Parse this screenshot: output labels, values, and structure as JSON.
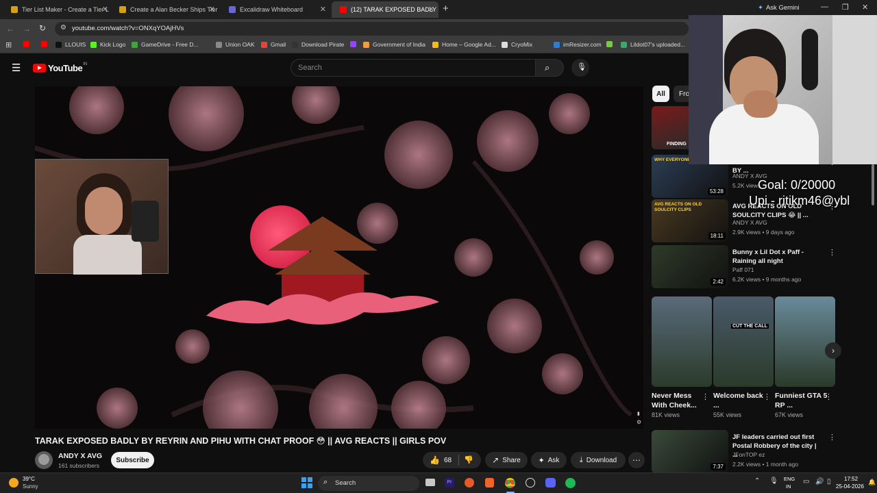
{
  "browser": {
    "tabs": [
      {
        "label": "Tier List Maker - Create a Tier L",
        "color": "#d4a017"
      },
      {
        "label": "Create a Alan Becker Ships Tier",
        "color": "#d4a017"
      },
      {
        "label": "Excalidraw Whiteboard",
        "color": "#6965db"
      },
      {
        "label": "(12) TARAK EXPOSED BADLY BY",
        "color": "#ff0000"
      }
    ],
    "new_tab": "+",
    "ask_gemini": "Ask Gemini",
    "url": "youtube.com/watch?v=ONXqYOAjHVs",
    "bookmarks": [
      {
        "label": "",
        "color": "#ff0000"
      },
      {
        "label": "",
        "color": "#ff0000"
      },
      {
        "label": "LLOUIS",
        "color": "#111111"
      },
      {
        "label": "Kick Logo",
        "color": "#53fc18"
      },
      {
        "label": "GameDrive - Free D...",
        "color": "#3ca83c"
      },
      {
        "label": "Union OAK",
        "color": "#888888"
      },
      {
        "label": "Gmail",
        "color": "#ea4335"
      },
      {
        "label": "Download Pirate",
        "color": "#333333"
      },
      {
        "label": "",
        "color": "#9146ff"
      },
      {
        "label": "Government of India",
        "color": "#ff9933"
      },
      {
        "label": "Home – Google Ad...",
        "color": "#fbbc04"
      },
      {
        "label": "CryoMix",
        "color": "#dddddd"
      },
      {
        "label": "imResizer.com",
        "color": "#2a7fd4"
      },
      {
        "label": "",
        "color": "#7ac943"
      },
      {
        "label": "Lildot07's uploaded...",
        "color": "#3ca86c"
      }
    ]
  },
  "youtube": {
    "logo_text": "YouTube",
    "region": "IN",
    "search_placeholder": "Search",
    "chips": [
      "All",
      "Fro"
    ],
    "video_title": "TARAK EXPOSED BADLY BY REYRIN AND PIHU WITH CHAT PROOF 😳 || AVG REACTS || GIRLS POV",
    "channel": "ANDY X AVG",
    "subscribers": "161 subscribers",
    "subscribe": "Subscribe",
    "likes": "68",
    "share": "Share",
    "ask": "Ask",
    "download": "Download",
    "stream_overlay": {
      "goal": "Goal: 0/20000",
      "upi": "Upi - ritikm46@ybl"
    },
    "recommendations": [
      {
        "title": "MANAGEMENT EXPOSED BY ...",
        "channel": "ANDY X AVG",
        "meta": "5.2K views",
        "duration": "53:28",
        "thumb_text": "WHY EVERYONE LEA",
        "thumb_color": "#2c3e55"
      },
      {
        "title": "AVG REACTS ON OLD SOULCITY CLIPS 😂 || ...",
        "channel": "ANDY X AVG",
        "meta": "2.9K views • 9 days ago",
        "duration": "18:11",
        "thumb_text": "AVG REACTS ON OLD SOULCITY CLIPS",
        "thumb_color": "#4a3a20"
      },
      {
        "title": "Bunny x Lil Dot x Paff - Raining all night",
        "channel": "Paff 071",
        "meta": "6.2K views • 9 months ago",
        "duration": "2:42",
        "thumb_text": "",
        "thumb_color": "#2f3a28"
      },
      {
        "title": "JF leaders carried out first Postal Robbery of the city | ...",
        "channel": "JFonTOP ez",
        "meta": "2.2K views • 1 month ago",
        "duration": "7:37",
        "thumb_text": "",
        "thumb_color": "#3a4a3a"
      }
    ],
    "top_thumb_text": "FINDING",
    "shorts": [
      {
        "title": "Never Mess With Cheek...",
        "views": "81K views",
        "thumb_text": "",
        "thumb_color": "#5a6a7a"
      },
      {
        "title": "Welcome back ...",
        "views": "55K views",
        "thumb_text": "CUT THE CALL",
        "thumb_color": "#4a5a6a"
      },
      {
        "title": "Funniest GTA 5 RP ...",
        "views": "67K views",
        "thumb_text": "",
        "thumb_color": "#6a8a9a"
      }
    ]
  },
  "taskbar": {
    "temperature": "39°C",
    "weather": "Sunny",
    "search": "Search",
    "lang": "ENG",
    "lang_region": "IN",
    "time": "17:52",
    "date": "25-04-2026"
  }
}
